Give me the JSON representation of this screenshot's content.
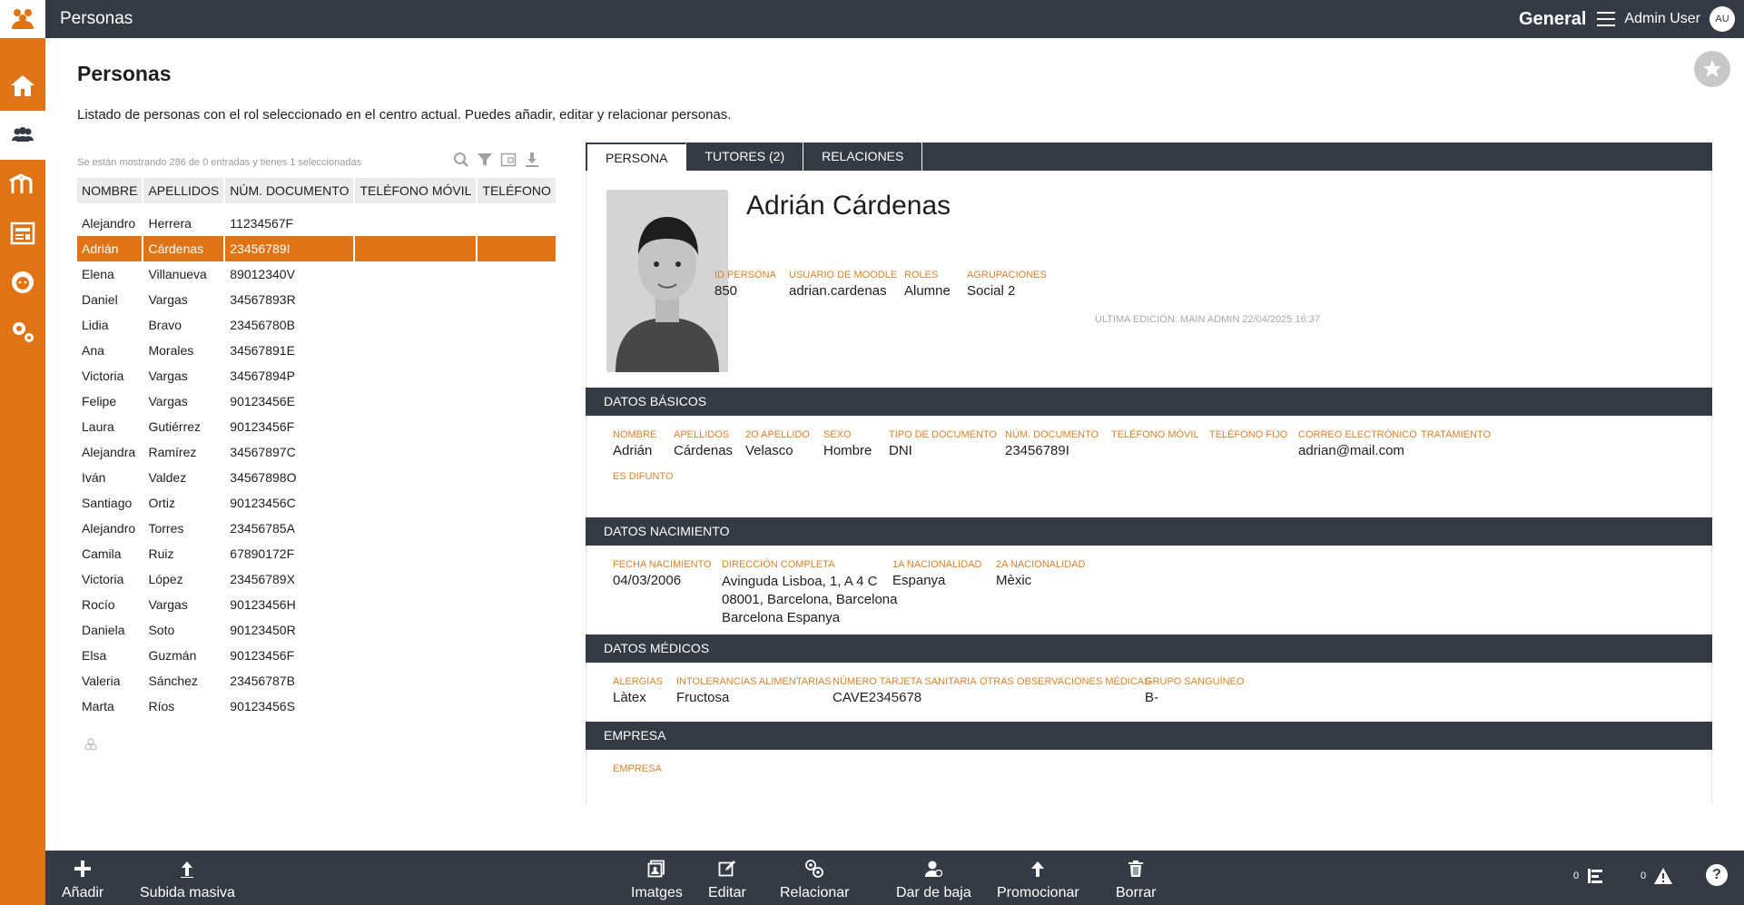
{
  "app": {
    "title": "Personas",
    "context": "General",
    "user": "Admin User",
    "user_initials": "AU"
  },
  "sidebar": {
    "items": [
      "home-icon",
      "people-icon",
      "moodle-icon",
      "news-icon",
      "student-icon",
      "settings-icon"
    ]
  },
  "page": {
    "title": "Personas",
    "description": "Listado de personas con el rol seleccionado en el centro actual. Puedes añadir, editar y relacionar personas."
  },
  "list": {
    "info": "Se están mostrando 286 de 0 entradas y tienes 1 seleccionadas",
    "columns": [
      "NOMBRE",
      "APELLIDOS",
      "NÚM. DOCUMENTO",
      "TELÉFONO MÓVIL",
      "TELÉFONO"
    ],
    "rows": [
      [
        "Alejandro",
        "Herrera",
        "11234567F",
        "",
        ""
      ],
      [
        "Adrián",
        "Cárdenas",
        "23456789I",
        "",
        ""
      ],
      [
        "Elena",
        "Villanueva",
        "89012340V",
        "",
        ""
      ],
      [
        "Daniel",
        "Vargas",
        "34567893R",
        "",
        ""
      ],
      [
        "Lidia",
        "Bravo",
        "23456780B",
        "",
        ""
      ],
      [
        "Ana",
        "Morales",
        "34567891E",
        "",
        ""
      ],
      [
        "Victoria",
        "Vargas",
        "34567894P",
        "",
        ""
      ],
      [
        "Felipe",
        "Vargas",
        "90123456E",
        "",
        ""
      ],
      [
        "Laura",
        "Gutiérrez",
        "90123456F",
        "",
        ""
      ],
      [
        "Alejandra",
        "Ramírez",
        "34567897C",
        "",
        ""
      ],
      [
        "Iván",
        "Valdez",
        "34567898O",
        "",
        ""
      ],
      [
        "Santiago",
        "Ortiz",
        "90123456C",
        "",
        ""
      ],
      [
        "Alejandro",
        "Torres",
        "23456785A",
        "",
        ""
      ],
      [
        "Camila",
        "Ruiz",
        "67890172F",
        "",
        ""
      ],
      [
        "Victoria",
        "López",
        "23456789X",
        "",
        ""
      ],
      [
        "Rocío",
        "Vargas",
        "90123456H",
        "",
        ""
      ],
      [
        "Daniela",
        "Soto",
        "90123450R",
        "",
        ""
      ],
      [
        "Elsa",
        "Guzmán",
        "90123456F",
        "",
        ""
      ],
      [
        "Valeria",
        "Sánchez",
        "23456787B",
        "",
        ""
      ],
      [
        "Marta",
        "Ríos",
        "90123456S",
        "",
        ""
      ]
    ],
    "selected_index": 1
  },
  "detail": {
    "tabs": [
      "PERSONA",
      "TUTORES (2)",
      "RELACIONES"
    ],
    "active_tab": 0,
    "name": "Adrián Cárdenas",
    "summary": {
      "id_label": "ID PERSONA",
      "id_value": "850",
      "moodle_label": "USUARIO DE MOODLE",
      "moodle_value": "adrian.cardenas",
      "roles_label": "ROLES",
      "roles_value": "Alumne",
      "groups_label": "AGRUPACIONES",
      "groups_value": "Social 2"
    },
    "last_edit": "ÚLTIMA EDICIÓN: MAIN ADMIN 22/04/2025 16:37",
    "basic": {
      "title": "DATOS BÁSICOS",
      "nombre_label": "NOMBRE",
      "nombre": "Adrián",
      "apellidos_label": "APELLIDOS",
      "apellidos": "Cárdenas",
      "apellido2_label": "2O APELLIDO",
      "apellido2": "Velasco",
      "sexo_label": "SEXO",
      "sexo": "Hombre",
      "tipo_doc_label": "TIPO DE DOCUMENTO",
      "tipo_doc": "DNI",
      "num_doc_label": "NÚM. DOCUMENTO",
      "num_doc": "23456789I",
      "movil_label": "TELÉFONO MÓVIL",
      "movil": "",
      "fijo_label": "TELÉFONO FIJO",
      "fijo": "",
      "email_label": "CORREO ELECTRÓNICO",
      "email": "adrian@mail.com",
      "tratamiento_label": "TRATAMIENTO",
      "tratamiento": "",
      "difunto_label": "ES DIFUNTO",
      "difunto": ""
    },
    "birth": {
      "title": "DATOS NACIMIENTO",
      "fecha_label": "FECHA NACIMIENTO",
      "fecha": "04/03/2006",
      "direccion_label": "DIRECCIÓN COMPLETA",
      "direccion_line1": "Avinguda Lisboa, 1, A 4 C",
      "direccion_line2": "08001, Barcelona, Barcelona",
      "direccion_line3": "Barcelona Espanya",
      "nac1_label": "1A NACIONALIDAD",
      "nac1": "Espanya",
      "nac2_label": "2A NACIONALIDAD",
      "nac2": "Mèxic"
    },
    "medical": {
      "title": "DATOS MÉDICOS",
      "alergias_label": "ALERGIAS",
      "alergias": "Làtex",
      "intol_label": "INTOLERANCIAS ALIMENTARIAS",
      "intol": "Fructosa",
      "tarjeta_label": "NÚMERO TARJETA SANITARIA",
      "tarjeta": "CAVE2345678",
      "obs_label": "OTRAS OBSERVACIONES MÉDICAS",
      "obs": "",
      "grupo_label": "GRUPO SANGUÍNEO",
      "grupo": "B-"
    },
    "company": {
      "title": "EMPRESA",
      "empresa_label": "EMPRESA"
    }
  },
  "toolbar": {
    "add": "Añadir",
    "bulk_upload": "Subida masiva",
    "images": "Imatges",
    "edit": "Editar",
    "relate": "Relacionar",
    "deregister": "Dar de baja",
    "promote": "Promocionar",
    "delete": "Borrar",
    "tasks_count": "0",
    "alerts_count": "0",
    "help": "?"
  },
  "colors": {
    "accent": "#e07414",
    "dark": "#353b45",
    "label": "#d9822b"
  }
}
